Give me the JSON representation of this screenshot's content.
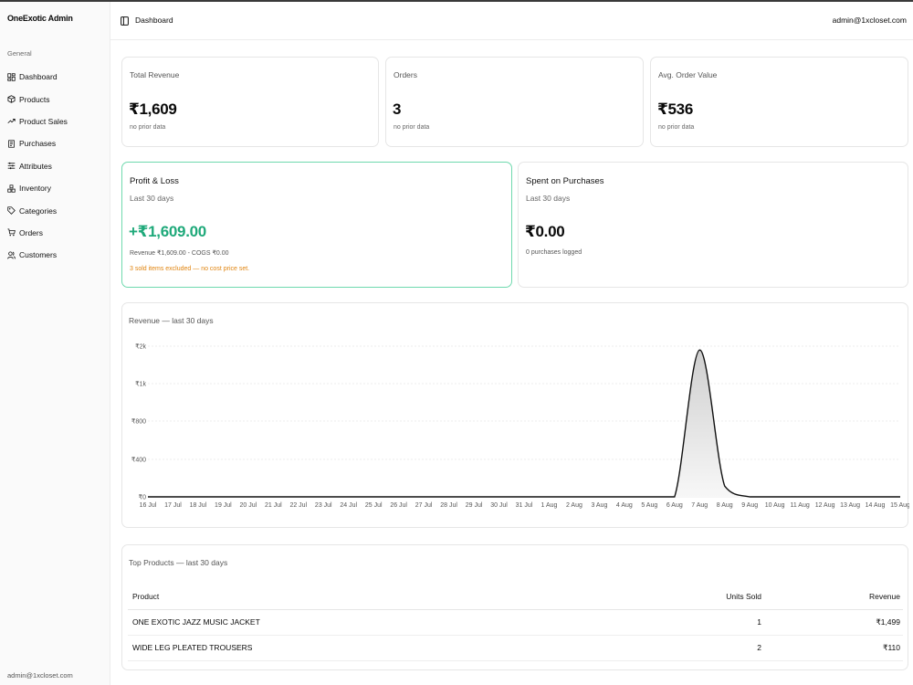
{
  "sidebar": {
    "brand": "OneExotic Admin",
    "group_label": "General",
    "items": [
      {
        "label": "Dashboard",
        "icon": "dashboard-icon"
      },
      {
        "label": "Products",
        "icon": "package-icon"
      },
      {
        "label": "Product Sales",
        "icon": "trending-up-icon"
      },
      {
        "label": "Purchases",
        "icon": "receipt-icon"
      },
      {
        "label": "Attributes",
        "icon": "sliders-icon"
      },
      {
        "label": "Inventory",
        "icon": "boxes-icon"
      },
      {
        "label": "Categories",
        "icon": "tag-icon"
      },
      {
        "label": "Orders",
        "icon": "cart-icon"
      },
      {
        "label": "Customers",
        "icon": "users-icon"
      }
    ],
    "footer_email": "admin@1xcloset.com"
  },
  "header": {
    "title": "Dashboard",
    "user_email": "admin@1xcloset.com",
    "toggle_icon": "sidebar-toggle-icon"
  },
  "stats": [
    {
      "label": "Total Revenue",
      "value": "₹1,609",
      "sub": "no prior data"
    },
    {
      "label": "Orders",
      "value": "3",
      "sub": "no prior data"
    },
    {
      "label": "Avg. Order Value",
      "value": "₹536",
      "sub": "no prior data"
    }
  ],
  "profit_loss": {
    "title": "Profit & Loss",
    "period": "Last 30 days",
    "value": "+₹1,609.00",
    "breakdown": "Revenue ₹1,609.00 - COGS ₹0.00",
    "warning": "3 sold items excluded — no cost price set.",
    "accent_color": "#1fa97a",
    "warning_color": "#e0840f"
  },
  "purchases": {
    "title": "Spent on Purchases",
    "period": "Last 30 days",
    "value": "₹0.00",
    "sub": "0 purchases logged"
  },
  "chart_title": "Revenue — last 30 days",
  "chart_data": {
    "type": "area",
    "title": "Revenue — last 30 days",
    "xlabel": "",
    "ylabel": "",
    "y_ticks": [
      "₹0",
      "₹400",
      "₹800",
      "₹1k",
      "₹2k"
    ],
    "x": [
      "16 Jul",
      "17 Jul",
      "18 Jul",
      "19 Jul",
      "20 Jul",
      "21 Jul",
      "22 Jul",
      "23 Jul",
      "24 Jul",
      "25 Jul",
      "26 Jul",
      "27 Jul",
      "28 Jul",
      "29 Jul",
      "30 Jul",
      "31 Jul",
      "1 Aug",
      "2 Aug",
      "3 Aug",
      "4 Aug",
      "5 Aug",
      "6 Aug",
      "7 Aug",
      "8 Aug",
      "9 Aug",
      "10 Aug",
      "11 Aug",
      "12 Aug",
      "13 Aug",
      "14 Aug",
      "15 Aug"
    ],
    "series": [
      {
        "values": [
          0,
          0,
          0,
          0,
          0,
          0,
          0,
          0,
          0,
          0,
          0,
          0,
          0,
          0,
          0,
          0,
          0,
          0,
          0,
          0,
          0,
          0,
          1499,
          110,
          0,
          0,
          0,
          0,
          0,
          0,
          0
        ]
      }
    ],
    "grid": true,
    "line_color": "#111111"
  },
  "top_products": {
    "title": "Top Products — last 30 days",
    "columns": [
      "Product",
      "Units Sold",
      "Revenue"
    ],
    "rows": [
      [
        "ONE EXOTIC JAZZ MUSIC JACKET",
        "1",
        "₹1,499"
      ],
      [
        "WIDE LEG PLEATED TROUSERS",
        "2",
        "₹110"
      ]
    ]
  }
}
